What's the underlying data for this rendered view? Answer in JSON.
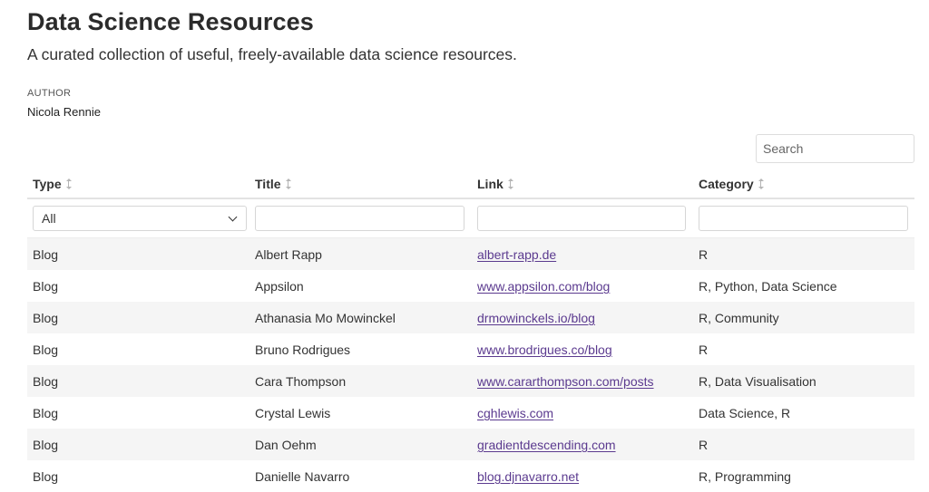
{
  "header": {
    "title": "Data Science Resources",
    "subtitle": "A curated collection of useful, freely-available data science resources.",
    "author_label": "AUTHOR",
    "author_name": "Nicola Rennie"
  },
  "search": {
    "placeholder": "Search",
    "value": ""
  },
  "table": {
    "columns": [
      "Type",
      "Title",
      "Link",
      "Category"
    ],
    "sort_icon": "sort-updown-icon",
    "filters": {
      "type_selected": "All",
      "title": "",
      "link": "",
      "category": ""
    },
    "rows": [
      {
        "type": "Blog",
        "title": "Albert Rapp",
        "link": "albert-rapp.de",
        "category": "R"
      },
      {
        "type": "Blog",
        "title": "Appsilon",
        "link": "www.appsilon.com/blog",
        "category": "R, Python, Data Science"
      },
      {
        "type": "Blog",
        "title": "Athanasia Mo Mowinckel",
        "link": "drmowinckels.io/blog",
        "category": "R, Community"
      },
      {
        "type": "Blog",
        "title": "Bruno Rodrigues",
        "link": "www.brodrigues.co/blog",
        "category": "R"
      },
      {
        "type": "Blog",
        "title": "Cara Thompson",
        "link": "www.cararthompson.com/posts",
        "category": "R, Data Visualisation"
      },
      {
        "type": "Blog",
        "title": "Crystal Lewis",
        "link": "cghlewis.com",
        "category": "Data Science, R"
      },
      {
        "type": "Blog",
        "title": "Dan Oehm",
        "link": "gradientdescending.com",
        "category": "R"
      },
      {
        "type": "Blog",
        "title": "Danielle Navarro",
        "link": "blog.djnavarro.net",
        "category": "R, Programming"
      }
    ]
  },
  "colors": {
    "link": "#5b3a8f",
    "stripe": "#f5f5f5",
    "text": "#333333"
  }
}
